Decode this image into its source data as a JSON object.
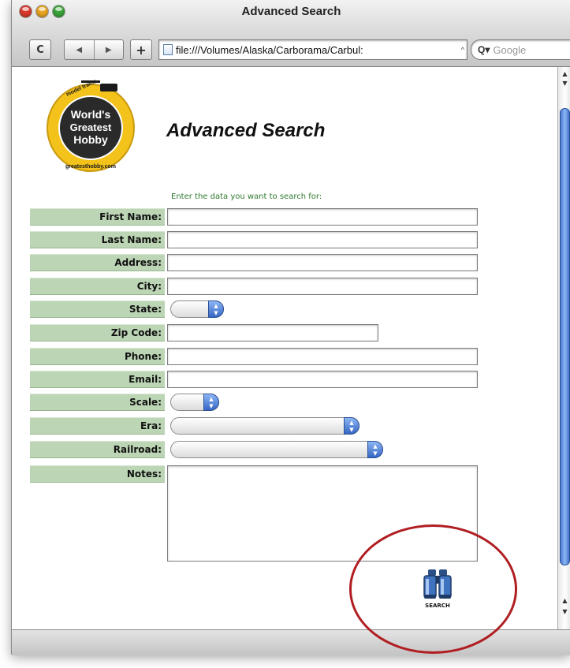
{
  "window": {
    "title": "Advanced Search"
  },
  "toolbar": {
    "reload_glyph": "C",
    "back_glyph": "◀",
    "forward_glyph": "▶",
    "add_glyph": "+",
    "url": "file:///Volumes/Alaska/Carborama/Carbul:",
    "url_arrow": "^",
    "search_glyph": "Q▾",
    "search_placeholder": "Google"
  },
  "logo": {
    "line1": "World's",
    "line2": "Greatest",
    "line3": "Hobby",
    "ring_top": "model trains",
    "ring_bottom": "greatesthobby.com"
  },
  "page": {
    "heading": "Advanced Search",
    "instructions": "Enter the data you want to search for:"
  },
  "form": {
    "fields": [
      {
        "label": "First Name:"
      },
      {
        "label": "Last Name:"
      },
      {
        "label": "Address:"
      },
      {
        "label": "City:"
      },
      {
        "label": "State:"
      },
      {
        "label": "Zip Code:"
      },
      {
        "label": "Phone:"
      },
      {
        "label": "Email:"
      },
      {
        "label": "Scale:"
      },
      {
        "label": "Era:"
      },
      {
        "label": "Railroad:"
      },
      {
        "label": "Notes:"
      }
    ],
    "search_label": "SEARCH"
  },
  "colors": {
    "label_bg": "#bcd6b5",
    "instruction_text": "#2f7a2f",
    "annotation_ring": "#b01e22",
    "aqua_blue": "#3566c2"
  }
}
